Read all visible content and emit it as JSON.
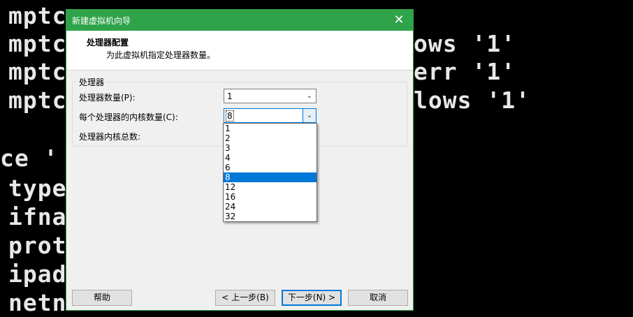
{
  "terminal": {
    "lines": [
      "mptc",
      "mptc",
      "mptc",
      "mptc",
      "ce '",
      "type",
      "ifna",
      "prot",
      "ipad",
      "netn"
    ],
    "fragments": [
      "ows '1'",
      "err '1'",
      "lows '1'"
    ]
  },
  "dialog": {
    "title": "新建虚拟机向导",
    "close_glyph": "✕",
    "header": {
      "title": "处理器配置",
      "subtitle": "为此虚拟机指定处理器数量。"
    },
    "group_label": "处理器",
    "processor_count": {
      "label": "处理器数量(P):",
      "value": "1",
      "arrow_icon": "chevron-down-icon"
    },
    "cores_per_processor": {
      "label": "每个处理器的内核数量(C):",
      "value": "8",
      "arrow_icon": "chevron-down-icon",
      "options": [
        "1",
        "2",
        "3",
        "4",
        "6",
        "8",
        "12",
        "16",
        "24",
        "32"
      ],
      "selected": "8"
    },
    "total_cores": {
      "label": "处理器内核总数:"
    },
    "buttons": {
      "help": "帮助",
      "back": "< 上一步(B)",
      "next": "下一步(N) >",
      "cancel": "取消"
    }
  },
  "colors": {
    "titlebar": "#2fa34a",
    "selection": "#0078d7"
  }
}
